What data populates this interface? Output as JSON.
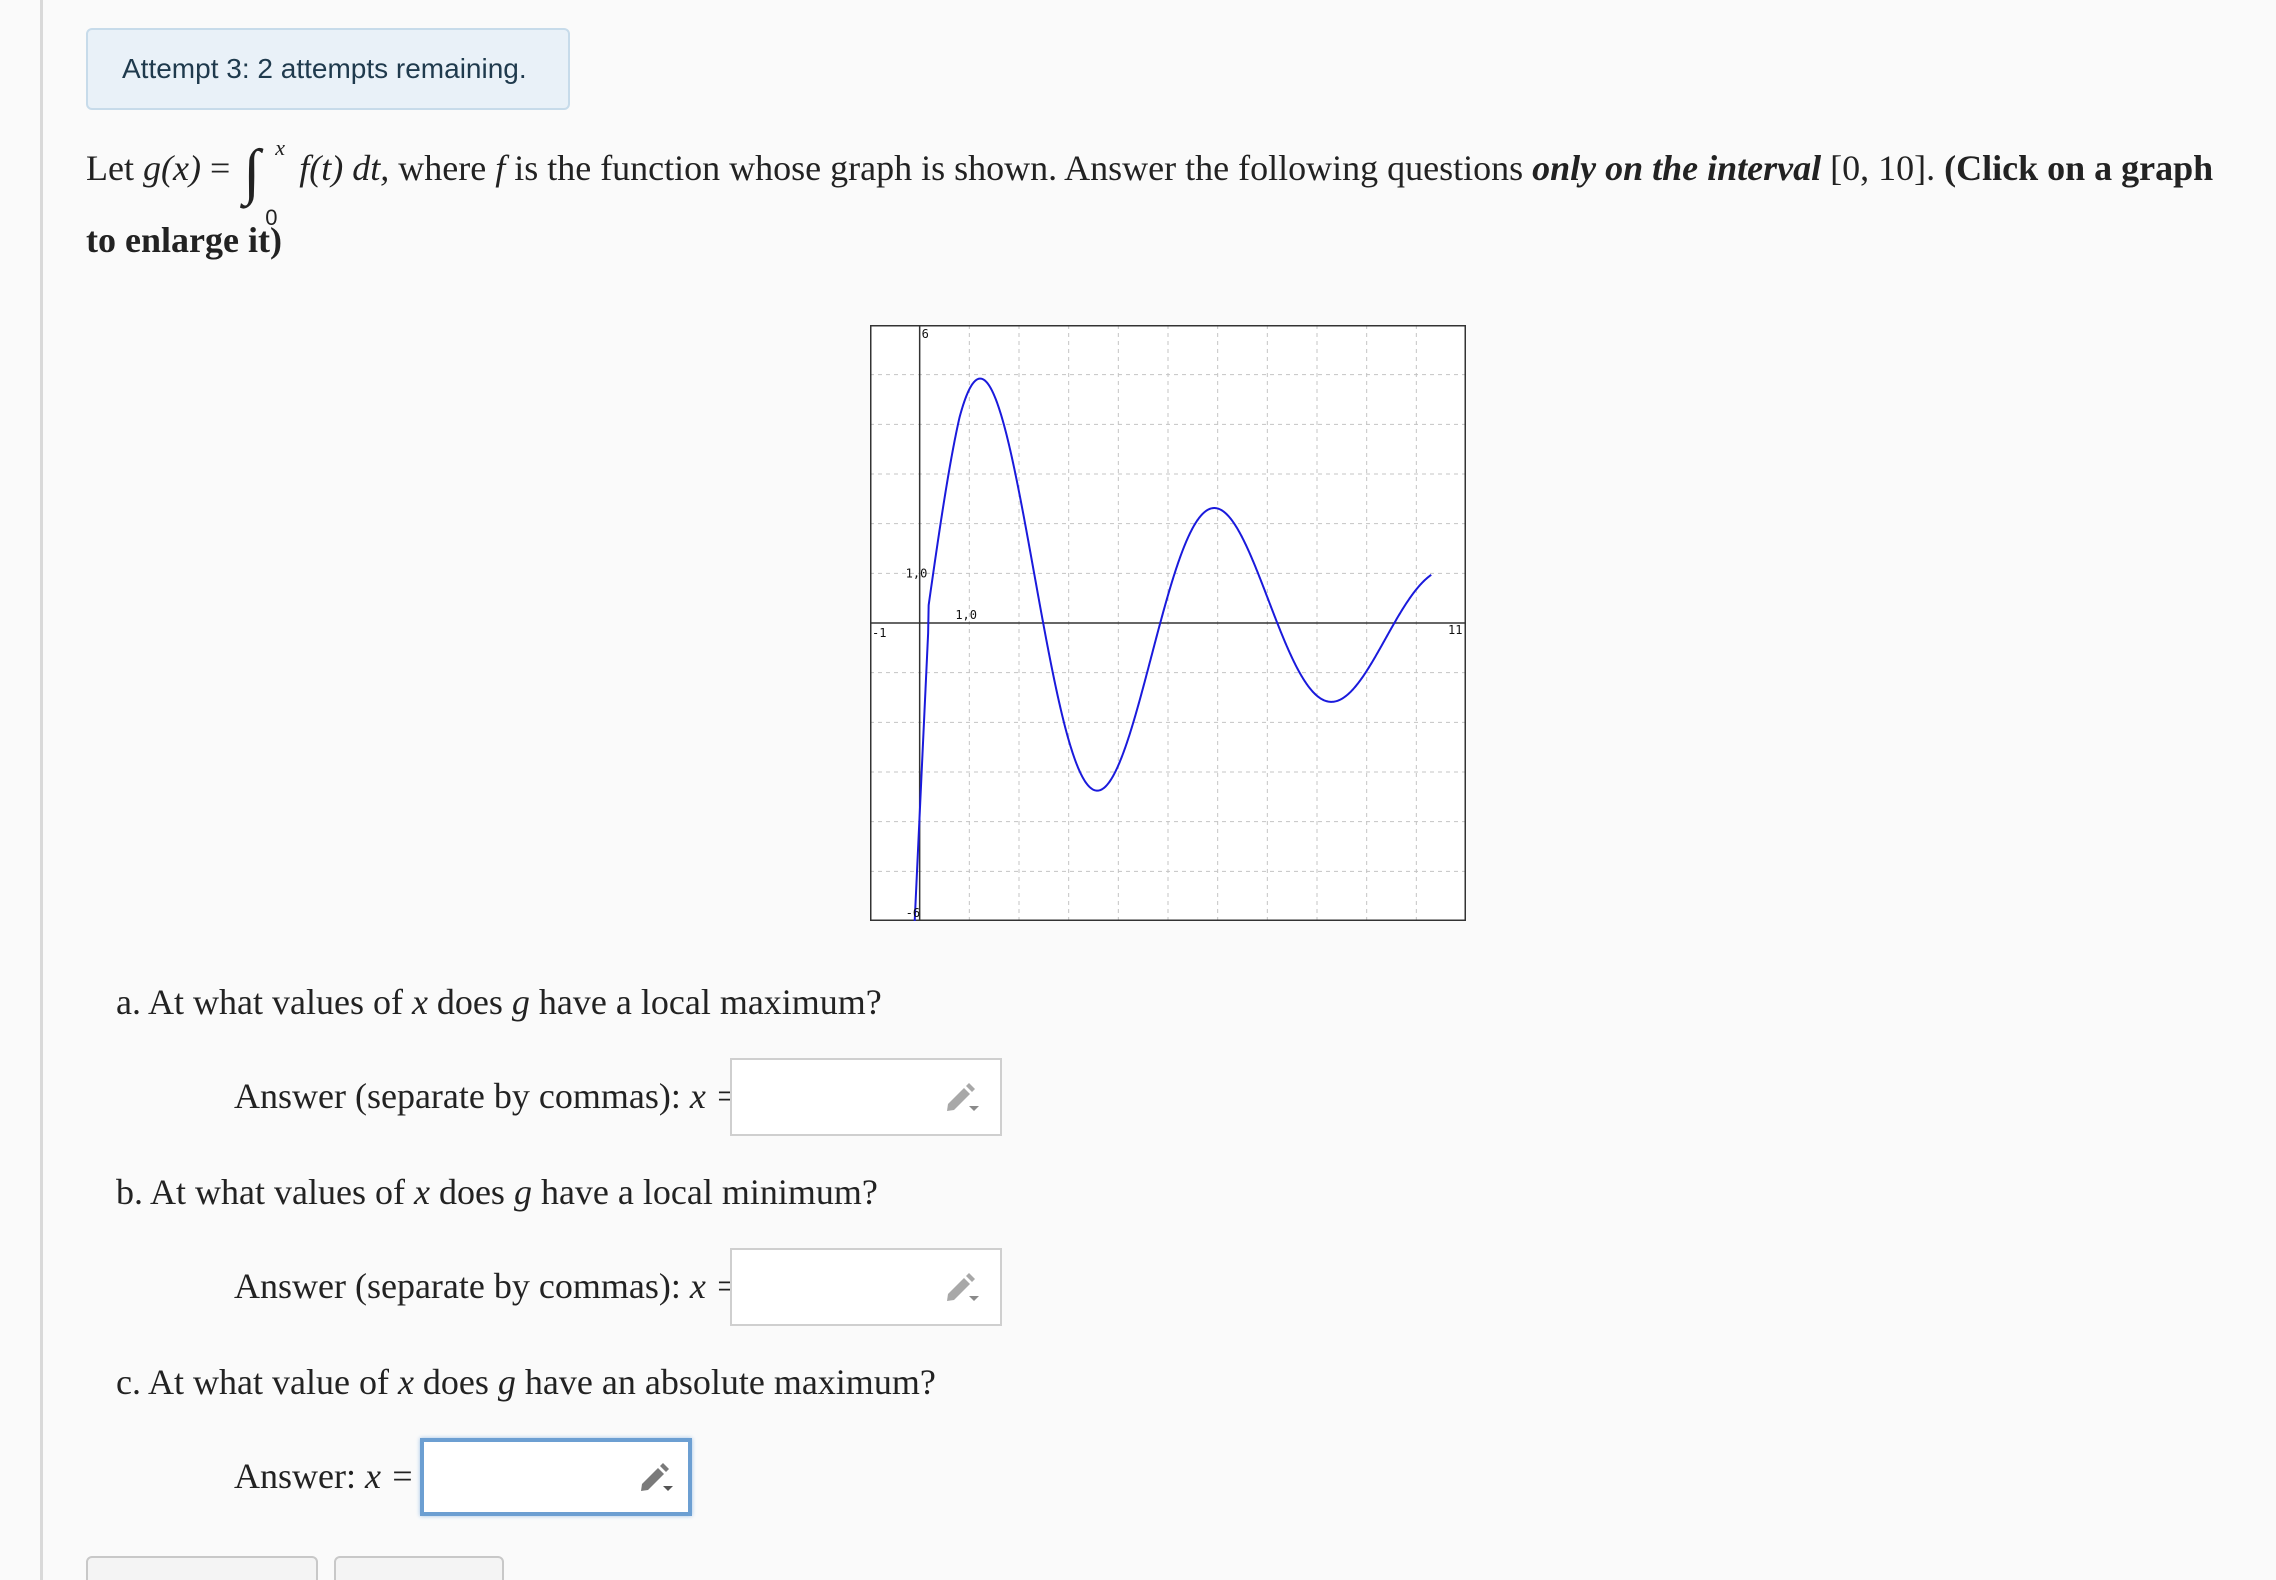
{
  "attempt": {
    "text": "Attempt 3: 2 attempts remaining."
  },
  "problem": {
    "let": "Let",
    "g_of_x": "g(x)",
    "equals": "=",
    "integral_upper": "x",
    "integral_lower": "0",
    "integrand": "f(t) dt,",
    "where": "where",
    "f": "f",
    "middle": "is the function whose graph is shown. Answer the following questions",
    "only_phrase": "only on the interval",
    "interval": "[0, 10].",
    "click_note": "(Click on a graph to enlarge it)"
  },
  "graph": {
    "curve_color": "#1a1adc",
    "tick_labels": {
      "y_top": "6",
      "y_bottom": "-6",
      "x_left": "-1",
      "x_right": "11",
      "y_unit": "1,0",
      "x_unit": "1,0"
    }
  },
  "questions": [
    {
      "marker": "a.",
      "text_before": "At what values of",
      "var": "x",
      "text_mid": "does",
      "func": "g",
      "text_after": "have a local maximum?",
      "answer_label": "Answer (separate by commas):",
      "answer_var": "x =",
      "answer_value": ""
    },
    {
      "marker": "b.",
      "text_before": "At what values of",
      "var": "x",
      "text_mid": "does",
      "func": "g",
      "text_after": "have a local minimum?",
      "answer_label": "Answer (separate by commas):",
      "answer_var": "x =",
      "answer_value": ""
    },
    {
      "marker": "c.",
      "text_before": "At what value of",
      "var": "x",
      "text_mid": "does",
      "func": "g",
      "text_after": "have an absolute maximum?",
      "answer_label": "Answer:",
      "answer_var": "x =",
      "answer_value": ""
    }
  ]
}
